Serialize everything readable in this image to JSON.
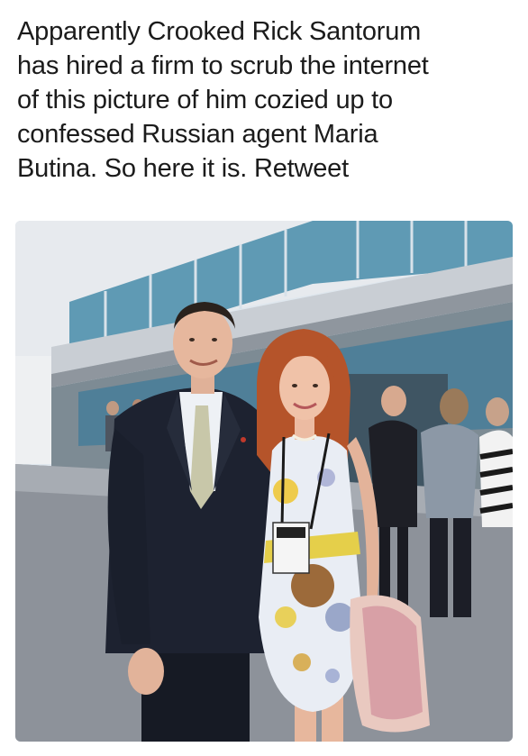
{
  "post": {
    "caption": "Apparently Crooked Rick Santorum\nhas hired a firm to scrub the internet\nof this picture of him cozied up to\nconfessed Russian agent Maria\nButina. So here it is.  Retweet"
  },
  "photo": {
    "subject": "photo-of-two-people-posing-outside-building"
  },
  "colors": {
    "text": "#1b1b1b",
    "background": "#ffffff",
    "sky": "#dfe7ee",
    "glass": "#5f9ab4",
    "pavement": "#8d929a",
    "suit": "#1d2230",
    "dress": "#e9edf4",
    "hair": "#b5542a"
  }
}
